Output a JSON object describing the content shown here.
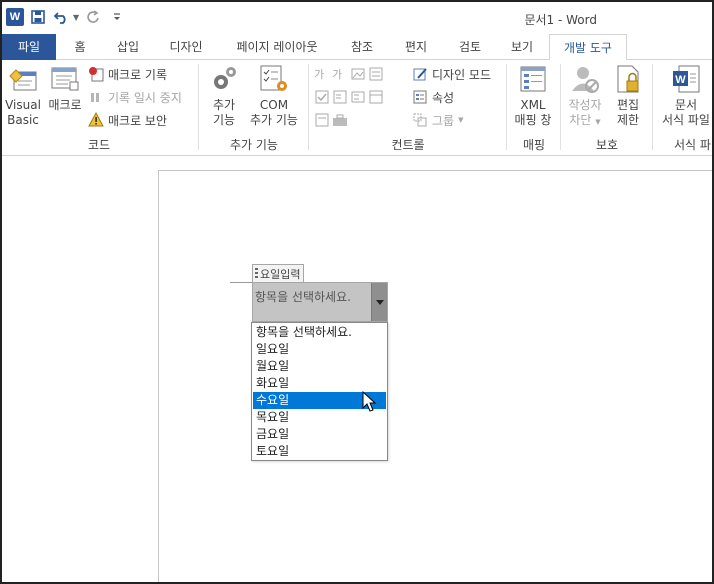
{
  "window": {
    "title": "문서1 - Word"
  },
  "qat": {
    "word_icon": "W",
    "save_icon": "save-icon",
    "undo_icon": "undo-icon",
    "redo_icon": "redo-icon",
    "customize_icon": "customize-icon"
  },
  "tabs": [
    {
      "label": "파일"
    },
    {
      "label": "홈"
    },
    {
      "label": "삽입"
    },
    {
      "label": "디자인"
    },
    {
      "label": "페이지 레이아웃"
    },
    {
      "label": "참조"
    },
    {
      "label": "편지"
    },
    {
      "label": "검토"
    },
    {
      "label": "보기"
    },
    {
      "label": "개발 도구"
    }
  ],
  "ribbon": {
    "code": {
      "label": "코드",
      "visual_basic_line1": "Visual",
      "visual_basic_line2": "Basic",
      "macro": "매크로",
      "record_macro": "매크로 기록",
      "pause_recording": "기록 일시 중지",
      "macro_security": "매크로 보안"
    },
    "addins": {
      "label": "추가 기능",
      "addins_line1": "추가",
      "addins_line2": "기능",
      "com_line1": "COM",
      "com_line2": "추가 기능"
    },
    "controls": {
      "label": "컨트롤",
      "design_mode": "디자인 모드",
      "properties": "속성",
      "group": "그룹"
    },
    "mapping": {
      "label": "매핑",
      "xml_line1": "XML",
      "xml_line2": "매핑 창"
    },
    "protect": {
      "label": "보호",
      "block_line1": "작성자",
      "block_line2": "차단",
      "restrict_line1": "편집",
      "restrict_line2": "제한"
    },
    "templates": {
      "label": "서식 파",
      "doc_line1": "문서",
      "doc_line2": "서식 파일"
    }
  },
  "content_control": {
    "title": "요일입력",
    "placeholder": "항목을 선택하세요.",
    "options": [
      "항목을 선택하세요.",
      "일요일",
      "월요일",
      "화요일",
      "수요일",
      "목요일",
      "금요일",
      "토요일"
    ],
    "selected_index": 4
  },
  "colors": {
    "accent": "#2b579a",
    "selection": "#0078d7"
  }
}
